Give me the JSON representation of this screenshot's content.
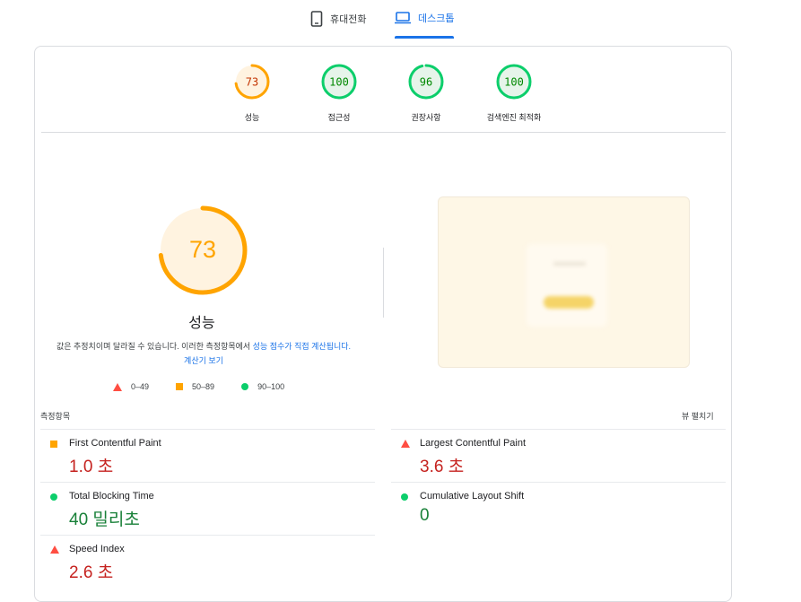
{
  "tabs": {
    "mobile": "휴대전화",
    "desktop": "데스크톱"
  },
  "categories": [
    {
      "score": "73",
      "label": "성능",
      "value": 0.73,
      "color": "#ffa400",
      "track": "#fff3e0",
      "text_color": "#c33300"
    },
    {
      "score": "100",
      "label": "접근성",
      "value": 1.0,
      "color": "#0cce6b",
      "track": "#e6f4ea",
      "text_color": "#008800"
    },
    {
      "score": "96",
      "label": "권장사항",
      "value": 0.96,
      "color": "#0cce6b",
      "track": "#e6f4ea",
      "text_color": "#008800"
    },
    {
      "score": "100",
      "label": "검색엔진 최적화",
      "value": 1.0,
      "color": "#0cce6b",
      "track": "#e6f4ea",
      "text_color": "#008800"
    }
  ],
  "performance": {
    "score": "73",
    "value": 0.73,
    "title": "성능",
    "note_text": "값은 추정치이며 달라질 수 있습니다. 이러한 측정항목에서 ",
    "note_link1": "성능 점수가 직접 계산됩니다.",
    "note_link2": "계산기 보기"
  },
  "legend": {
    "fail": "0–49",
    "average": "50–89",
    "pass": "90–100"
  },
  "metrics_section": {
    "title": "측정항목",
    "expand": "뷰 펼치기"
  },
  "metrics": {
    "fcp": {
      "name": "First Contentful Paint",
      "value": "1.0 초",
      "status": "average"
    },
    "lcp": {
      "name": "Largest Contentful Paint",
      "value": "3.6 초",
      "status": "fail"
    },
    "tbt": {
      "name": "Total Blocking Time",
      "value": "40 밀리초",
      "status": "pass"
    },
    "cls": {
      "name": "Cumulative Layout Shift",
      "value": "0",
      "status": "pass"
    },
    "si": {
      "name": "Speed Index",
      "value": "2.6 초",
      "status": "fail"
    }
  },
  "colors": {
    "accent": "#1a73e8",
    "fail": "#ff4e42",
    "average": "#ffa400",
    "pass": "#0cce6b"
  }
}
